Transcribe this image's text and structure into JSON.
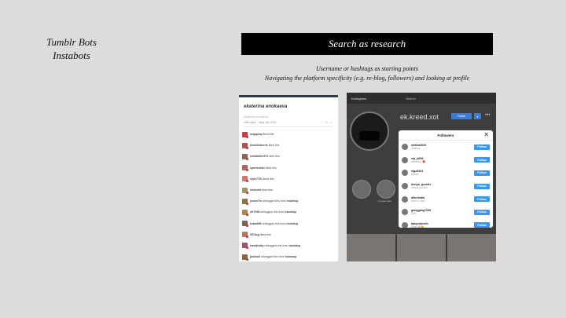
{
  "left_title": {
    "line1": "Tumblr Bots",
    "line2": "Instabots"
  },
  "banner": {
    "text": "Search as research"
  },
  "subtext": {
    "line1": "Username or hashtags as starting points",
    "line2": "Navigating the platform specificity (e.g. re-blog, followers) and looking at profile"
  },
  "tumblr": {
    "blog_title": "ekaterina enokaeva",
    "subtitle": "ekaterina enokaeva",
    "notes_count": "166 notes",
    "date": "May 1st, 2015",
    "notes": [
      {
        "user": "mojaprap",
        "action": "liked this",
        "color": "#b44"
      },
      {
        "user": "lionlollzberris",
        "action": "liked this",
        "color": "#a55"
      },
      {
        "user": "serialkiller974",
        "action": "liked this",
        "color": "#865"
      },
      {
        "user": "sporterluke",
        "action": "liked this",
        "color": "#a66"
      },
      {
        "user": "style7751",
        "action": "liked this",
        "color": "#c77"
      },
      {
        "user": "eisieorld",
        "action": "liked this",
        "color": "#996"
      },
      {
        "user": "yosse7m",
        "action": "reblogged this from",
        "from": "hstmbsp",
        "color": "#874"
      },
      {
        "user": "xfr7498",
        "action": "reblogged this from",
        "from": "hstmbsp",
        "color": "#a85"
      },
      {
        "user": "ksbw859",
        "action": "reblogged this from",
        "from": "hstmbsp",
        "color": "#765"
      },
      {
        "user": "357beg",
        "action": "liked this",
        "color": "#b76"
      },
      {
        "user": "wzmjheiky",
        "action": "reblogged this from",
        "from": "hstmbsp",
        "color": "#956"
      },
      {
        "user": "jkalina3",
        "action": "reblogged this from",
        "from": "hstmbsp",
        "color": "#864"
      }
    ]
  },
  "instagram": {
    "logo": "Instagram",
    "search": "Search",
    "username": "ek.kreed.xot",
    "follow_label": "Follow",
    "drop_label": "▾",
    "more_label": "•••",
    "highlights": [
      "",
      "лучшее моё..."
    ],
    "modal": {
      "title": "Followers",
      "close": "✕",
      "rows": [
        {
          "name": "stellka2020",
          "full": "Stellaxx",
          "button": "Follow"
        },
        {
          "name": "vip_p008",
          "full": "verified♛ 🎁",
          "button": "Follow"
        },
        {
          "name": "elgo5161",
          "full": "Ирина",
          "button": "Follow"
        },
        {
          "name": "dunya_guzaler",
          "full": "dunya_guzaler",
          "button": "Follow"
        },
        {
          "name": "afterlindia",
          "full": "After in india",
          "button": "Follow"
        },
        {
          "name": "ganggang7059",
          "full": "ВЛБ",
          "button": "Follow"
        },
        {
          "name": "babycakesfx",
          "full": "Nika! 🌸😘",
          "button": "Follow"
        }
      ]
    }
  }
}
